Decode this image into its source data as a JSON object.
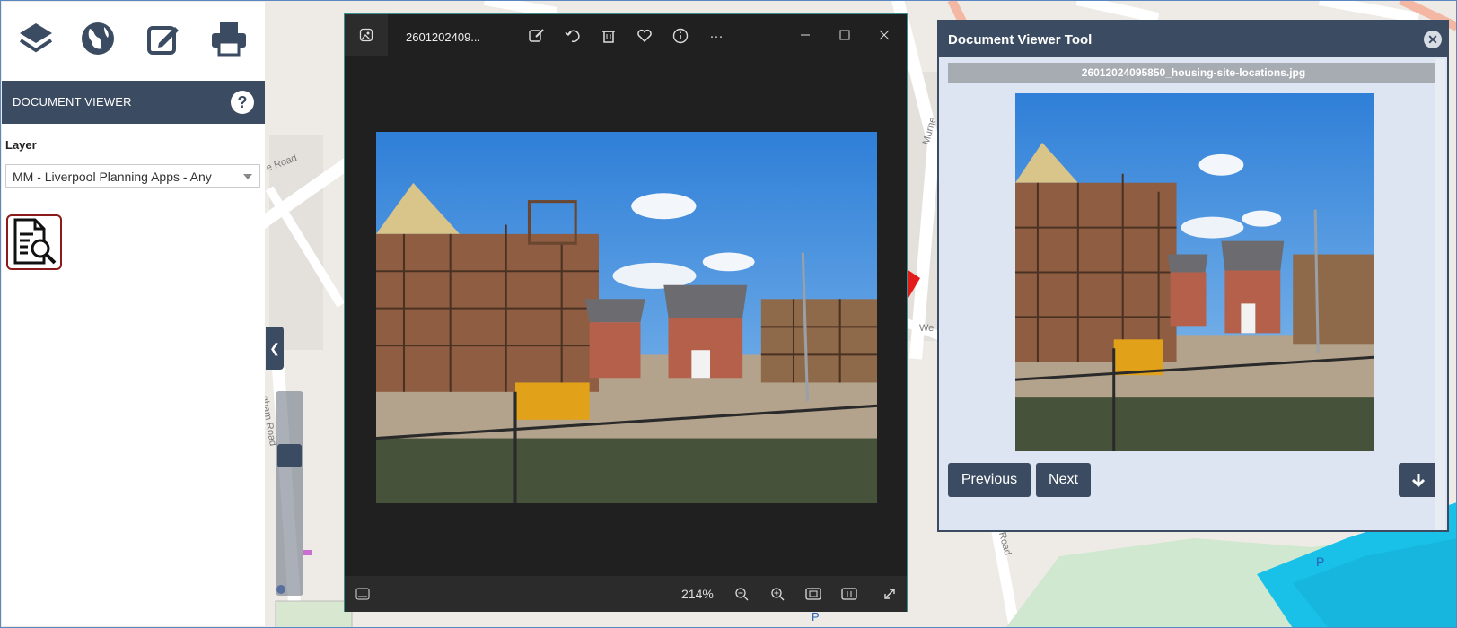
{
  "map": {
    "street_labels": [
      "e Road",
      "gham Road",
      "Murhe",
      "We",
      "Road",
      "P",
      "P"
    ]
  },
  "sidebar": {
    "tools": [
      {
        "icon": "layers-icon"
      },
      {
        "icon": "globe-icon"
      },
      {
        "icon": "edit-icon"
      },
      {
        "icon": "print-icon"
      }
    ],
    "panel_title": "DOCUMENT VIEWER",
    "help_label": "?",
    "layer_label": "Layer",
    "layer_value": "MM - Liverpool Planning Apps - Any",
    "doc_tool_icon": "document-search-icon",
    "collapse_label": "❮"
  },
  "photos": {
    "file_name": "2601202409...",
    "toolbar_icons": [
      "edit-image-icon",
      "rotate-icon",
      "delete-icon",
      "favorite-icon",
      "info-icon",
      "more-icon"
    ],
    "more_label": "···",
    "zoom_text": "214%",
    "bottom_icons": [
      "filmstrip-icon",
      "zoom-out-icon",
      "zoom-in-icon",
      "fit-icon",
      "actual-size-icon",
      "fullscreen-icon"
    ]
  },
  "doc_viewer": {
    "title": "Document Viewer Tool",
    "close_label": "✕",
    "file_name": "26012024095850_housing-site-locations.jpg",
    "previous_label": "Previous",
    "next_label": "Next",
    "download_label": "🡇"
  },
  "colors": {
    "panel_header": "#3b4b61",
    "photos_bg": "#202020",
    "viewer_bg": "#dde5f2"
  }
}
